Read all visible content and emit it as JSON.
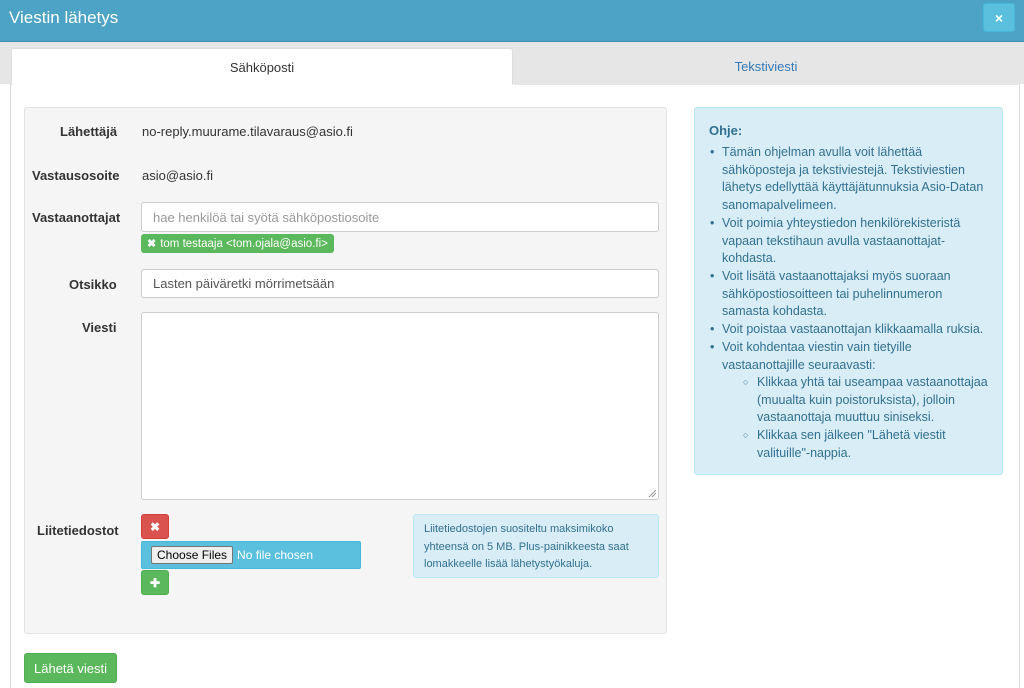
{
  "window": {
    "title": "Viestin lähetys",
    "close_icon": "×"
  },
  "tabs": [
    {
      "label": "Sähköposti",
      "active": true
    },
    {
      "label": "Tekstiviesti",
      "active": false
    }
  ],
  "form": {
    "sender_label": "Lähettäjä",
    "sender_value": "no-reply.muurame.tilavaraus@asio.fi",
    "reply_label": "Vastausosoite",
    "reply_value": "asio@asio.fi",
    "recipients_label": "Vastaanottajat",
    "recipients_placeholder": "hae henkilöä tai syötä sähköpostiosoite",
    "recipient_tag": "tom testaaja <tom.ojala@asio.fi>",
    "subject_label": "Otsikko",
    "subject_value": "Lasten päiväretki mörrimetsään",
    "message_label": "Viesti",
    "message_value": "",
    "attachments_label": "Liitetiedostot",
    "remove_icon": "✖",
    "add_icon": "✚",
    "file_button": "Choose Files",
    "file_status": "No file chosen",
    "attach_note_lines": [
      "Liitetiedostojen suositeltu maksimikoko",
      "yhteensä on 5 MB. Plus-painikkeesta saat",
      "lomakkeelle lisää lähetystyökaluja."
    ]
  },
  "help": {
    "title": "Ohje:",
    "items": [
      [
        "Tämän ohjelman avulla voit lähettää",
        "sähköposteja ja tekstiviestejä. Tekstiviestien",
        "lähetys edellyttää käyttäjätunnuksia Asio-Datan",
        "sanomapalvelimeen."
      ],
      [
        "Voit poimia yhteystiedon henkilörekisteristä",
        "vapaan tekstihaun avulla vastaanottajat-",
        "kohdasta."
      ],
      [
        "Voit lisätä vastaanottajaksi myös suoraan",
        "sähköpostiosoitteen tai puhelinnumeron",
        "samasta kohdasta."
      ],
      [
        "Voit poistaa vastaanottajan klikkaamalla ruksia."
      ],
      [
        "Voit kohdentaa viestin vain tietyille",
        "vastaanottajille seuraavasti:"
      ]
    ],
    "subitems": [
      [
        "Klikkaa yhtä tai useampaa vastaanottajaa",
        "(muualta kuin poistoruksista), jolloin",
        "vastaanottaja muuttuu siniseksi."
      ],
      [
        "Klikkaa sen jälkeen \"Lähetä viestit",
        "valituille\"-nappia."
      ]
    ]
  },
  "send_button": "Lähetä viesti"
}
